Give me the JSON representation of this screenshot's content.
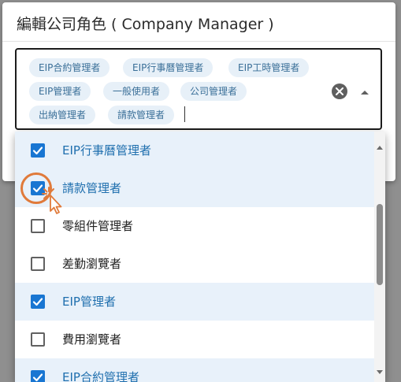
{
  "dialog": {
    "title": "編輯公司角色 ( Company Manager )"
  },
  "select": {
    "chips": [
      {
        "label": "EIP合約管理者"
      },
      {
        "label": "EIP行事曆管理者"
      },
      {
        "label": "EIP工時管理者"
      },
      {
        "label": "EIP管理者"
      },
      {
        "label": "一般使用者"
      },
      {
        "label": "公司管理者"
      },
      {
        "label": "出納管理者"
      },
      {
        "label": "請款管理者"
      }
    ],
    "clear_icon": "close-circle-icon",
    "toggle_icon": "arrow-drop-up-icon"
  },
  "listbox": {
    "options": [
      {
        "label": "EIP行事曆管理者",
        "checked": true
      },
      {
        "label": "請款管理者",
        "checked": true
      },
      {
        "label": "零組件管理者",
        "checked": false
      },
      {
        "label": "差勤瀏覽者",
        "checked": false
      },
      {
        "label": "EIP管理者",
        "checked": true
      },
      {
        "label": "費用瀏覽者",
        "checked": false
      },
      {
        "label": "EIP合約管理者",
        "checked": true
      }
    ]
  },
  "colors": {
    "accent": "#1976d2",
    "chip_bg": "#e7f0f8",
    "chip_text": "#3a6f98",
    "selected_row": "#e8f1fa",
    "click_highlight": "#e07a3a"
  }
}
